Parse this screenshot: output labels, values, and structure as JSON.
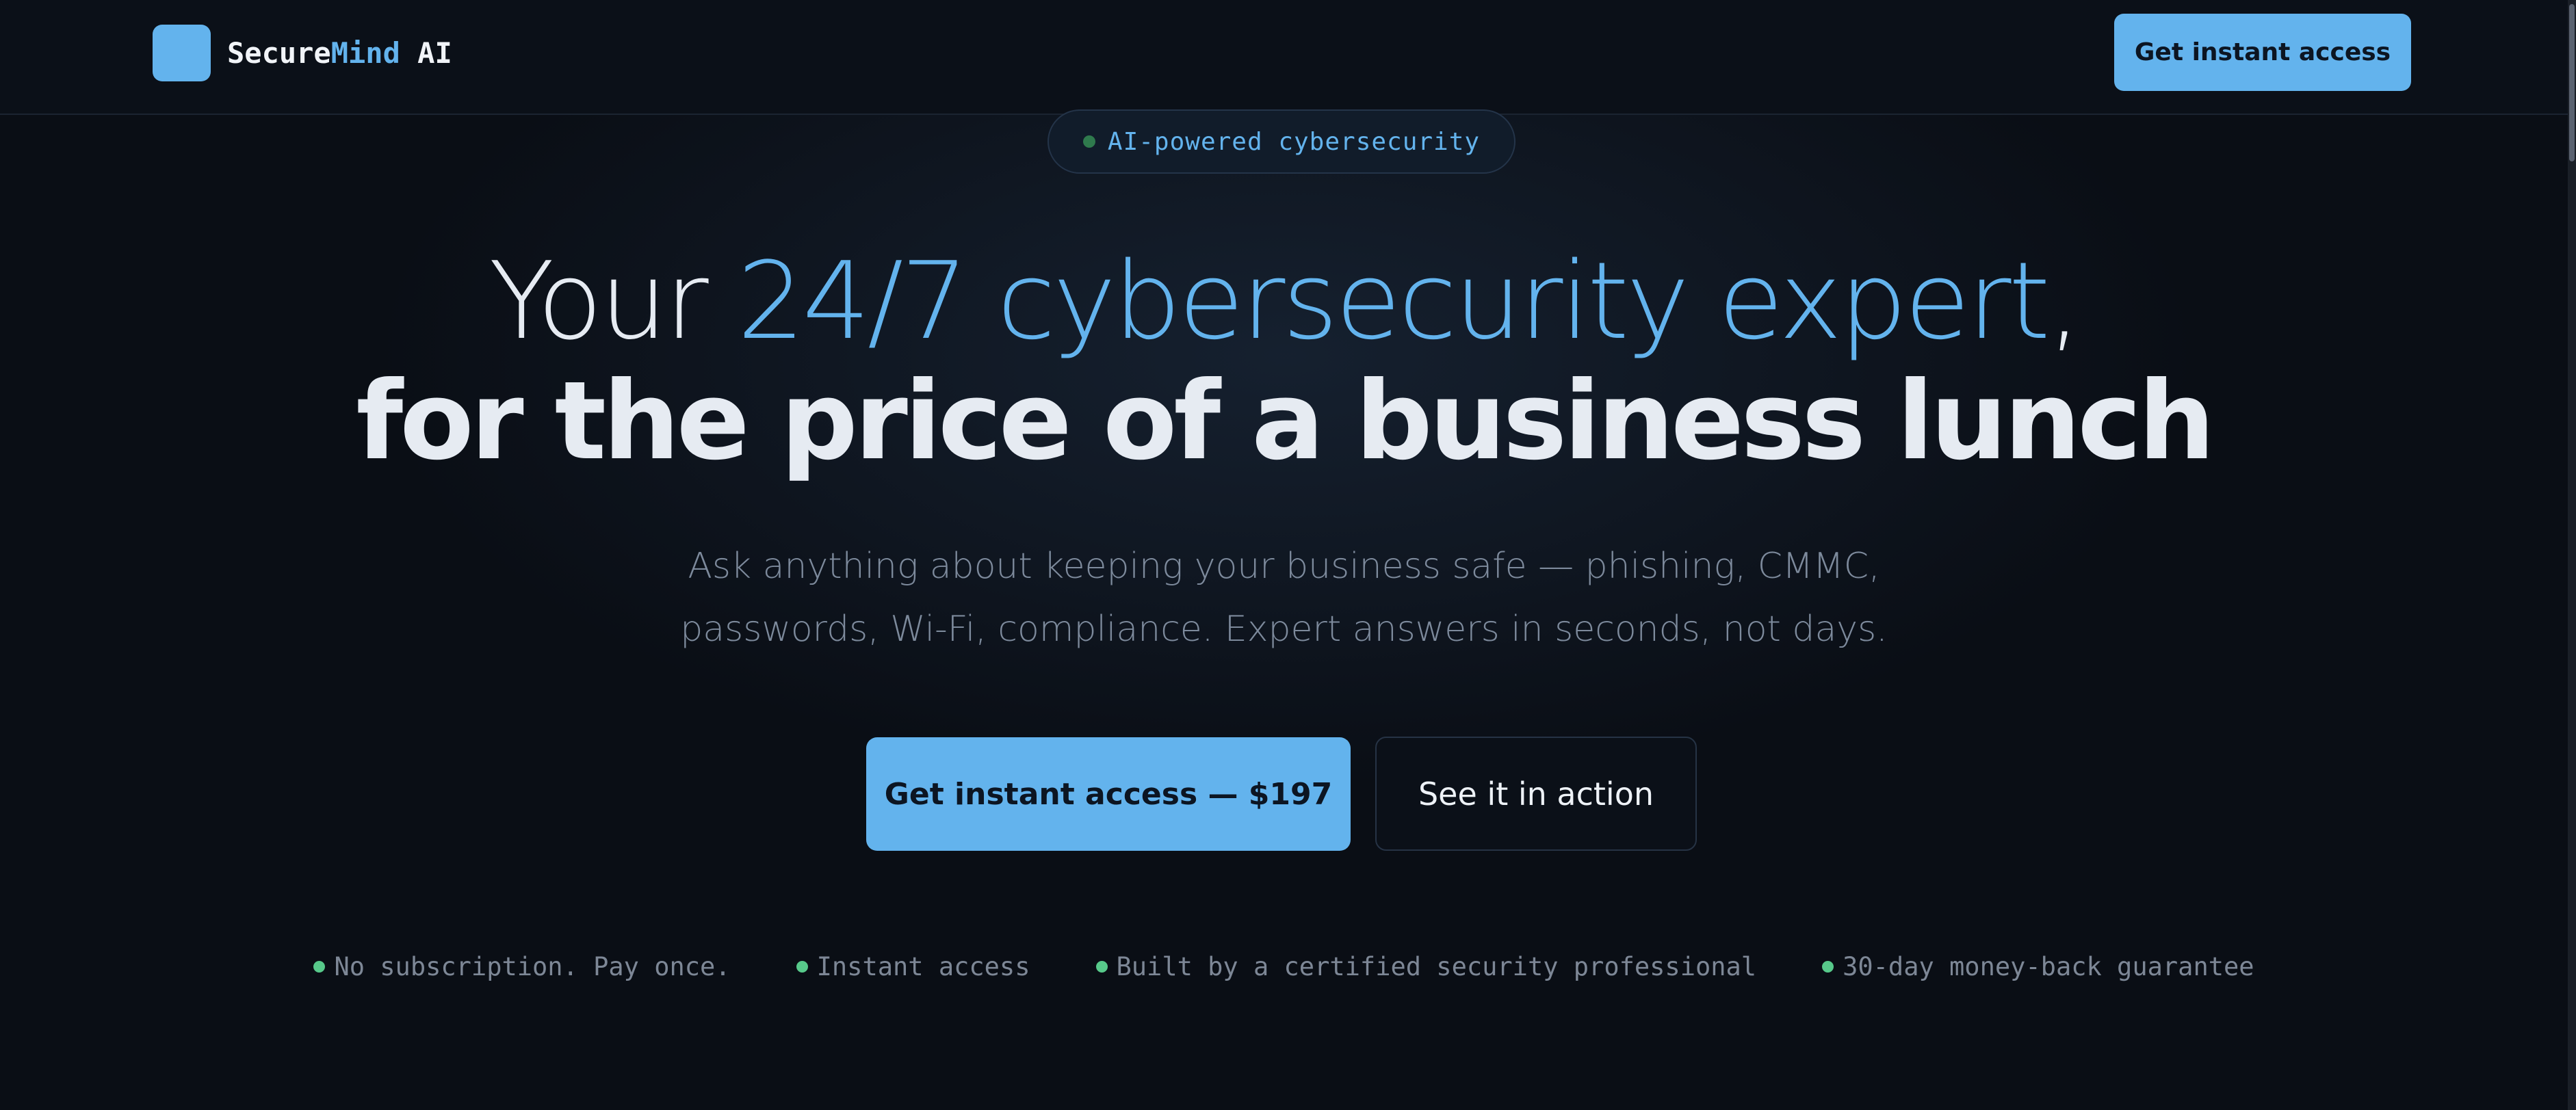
{
  "nav": {
    "logo_icon": "logo-square",
    "brand_part1": "Secure",
    "brand_part2": "Mind",
    "brand_part3": " AI",
    "cta_label": "Get instant access"
  },
  "badge": {
    "text": "AI-powered cybersecurity",
    "dot_color": "#2f7a4d"
  },
  "headline": {
    "line1_prefix": "Your ",
    "line1_accent": "24/7 cybersecurity expert",
    "line1_suffix": ",",
    "line2": "for the price of a business lunch"
  },
  "subtitle": {
    "line1": "Ask anything about keeping your business safe — phishing, CMMC,",
    "line2": "passwords, Wi-Fi, compliance. Expert answers in seconds, not days."
  },
  "cta": {
    "primary_label": "Get instant access — $197",
    "secondary_label": "See it in action"
  },
  "trust": {
    "items": [
      "No subscription. Pay once.",
      "Instant access",
      "Built by a certified security professional",
      "30-day money-back guarantee"
    ],
    "dot_color": "#57c98a"
  },
  "colors": {
    "background": "#0a0e15",
    "accent": "#63b3ed",
    "text_primary": "#e6ebf2",
    "text_muted": "#7d8a9c"
  }
}
